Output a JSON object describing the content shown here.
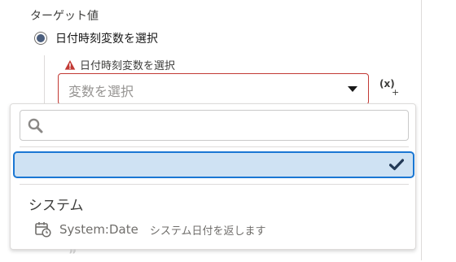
{
  "target": {
    "section_label": "ターゲット値",
    "radio_label": "日付時刻変数を選択",
    "radio_selected": true
  },
  "field": {
    "label": "日付時刻変数を選択",
    "error_icon": "warning-icon",
    "placeholder": "変数を選択"
  },
  "fx_button": {
    "main": "(x)",
    "plus": "+"
  },
  "dropdown": {
    "search_value": "",
    "selected_option_label": "",
    "group_header": "システム",
    "options": [
      {
        "title": "System:Date",
        "description": "システム日付を返します",
        "icon": "calendar-clock-icon"
      }
    ]
  },
  "background_glyph": "”",
  "colors": {
    "error": "#c23934",
    "focus": "#1b77d3",
    "selected_bg": "#cfe2f3"
  }
}
